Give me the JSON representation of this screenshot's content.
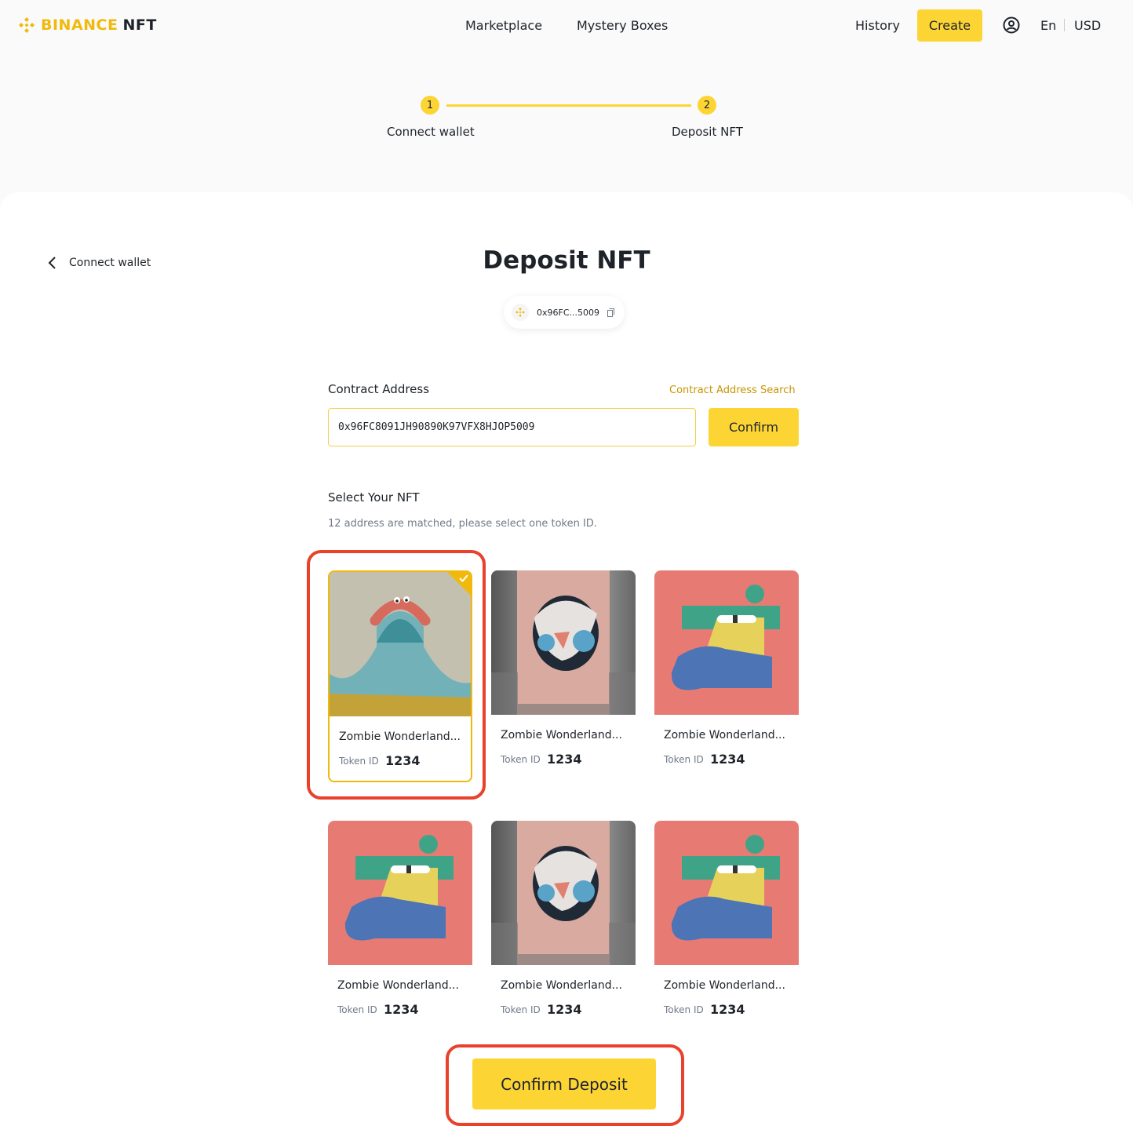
{
  "header": {
    "logo_brand": "BINANCE",
    "logo_suffix": "NFT",
    "nav": [
      "Marketplace",
      "Mystery Boxes"
    ],
    "history": "History",
    "create": "Create",
    "language": "En",
    "currency": "USD"
  },
  "steps": [
    {
      "num": "1",
      "label": "Connect wallet"
    },
    {
      "num": "2",
      "label": "Deposit NFT"
    }
  ],
  "back_label": "Connect wallet",
  "title": "Deposit NFT",
  "wallet": {
    "address": "0x96FC...5009"
  },
  "contract": {
    "label": "Contract Address",
    "search_link": "Contract Address Search",
    "value": "0x96FC8091JH90890K97VFX8HJOP5009",
    "confirm": "Confirm"
  },
  "select": {
    "title": "Select Your NFT",
    "hint": "12 address are matched, please select one token ID."
  },
  "nfts": [
    {
      "name": "Zombie Wonderland...",
      "token_label": "Token ID",
      "token_id": "1234",
      "art": "blob",
      "selected": true
    },
    {
      "name": "Zombie Wonderland...",
      "token_label": "Token ID",
      "token_id": "1234",
      "art": "ribbon",
      "selected": false
    },
    {
      "name": "Zombie Wonderland...",
      "token_label": "Token ID",
      "token_id": "1234",
      "art": "zombie",
      "selected": false
    },
    {
      "name": "Zombie Wonderland...",
      "token_label": "Token ID",
      "token_id": "1234",
      "art": "zombie",
      "selected": false
    },
    {
      "name": "Zombie Wonderland...",
      "token_label": "Token ID",
      "token_id": "1234",
      "art": "ribbon",
      "selected": false
    },
    {
      "name": "Zombie Wonderland...",
      "token_label": "Token ID",
      "token_id": "1234",
      "art": "zombie",
      "selected": false
    }
  ],
  "confirm_deposit": "Confirm Deposit",
  "colors": {
    "accent": "#fcd535",
    "brand": "#f0b90b",
    "link": "#c99400",
    "annotation": "#e8412c"
  }
}
